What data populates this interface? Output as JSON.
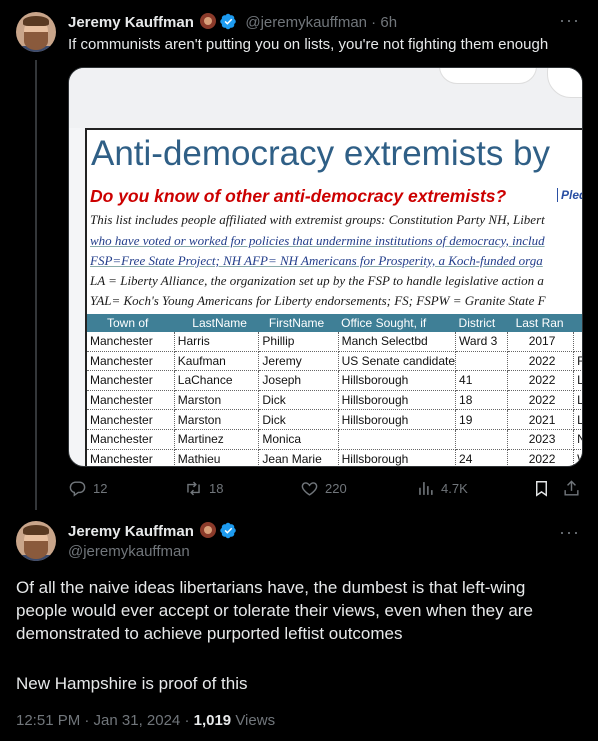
{
  "tweet1": {
    "display_name": "Jeremy Kauffman",
    "handle": "@jeremykauffman",
    "time": "6h",
    "text": "If communists aren't putting you on lists, you're not fighting them enough",
    "stats": {
      "replies": "12",
      "reposts": "18",
      "likes": "220",
      "views": "4.7K"
    },
    "image": {
      "title": "Anti-democracy extremists by",
      "subtitle": "Do you know of other anti-democracy extremists?",
      "pledge_link": "Pled",
      "lines": [
        "This list includes people affiliated with extremist groups: Constitution Party NH, Libert",
        "who have voted or worked for policies that undermine institutions of democracy, includ",
        "FSP=Free State Project; NH AFP= NH Americans for Prosperity, a Koch-funded orga",
        "LA = Liberty Alliance, the organization set up by the FSP to handle legislative action a",
        "YAL= Koch's Young Americans for Liberty endorsements; FS; FSPW = Granite State F"
      ],
      "table_headers": [
        "Town of",
        "LastName",
        "FirstName",
        "Office Sought, if",
        "District",
        "Last Ran",
        ""
      ],
      "table_rows": [
        [
          "Manchester",
          "Harris",
          "Phillip",
          "Manch Selectbd",
          "Ward 3",
          "2017",
          ""
        ],
        [
          "Manchester",
          "Kaufman",
          "Jeremy",
          "US Senate candidate",
          "",
          "2022",
          "FSP"
        ],
        [
          "Manchester",
          "LaChance",
          "Joseph",
          "Hillsborough",
          "41",
          "2022",
          "Libe"
        ],
        [
          "Manchester",
          "Marston",
          "Dick",
          "Hillsborough",
          "18",
          "2022",
          "Libe"
        ],
        [
          "Manchester",
          "Marston",
          "Dick",
          "Hillsborough",
          "19",
          "2021",
          "Libe"
        ],
        [
          "Manchester",
          "Martinez",
          "Monica",
          "",
          "",
          "2023",
          "NH"
        ],
        [
          "Manchester",
          "Mathieu",
          "Jean Marie",
          "Hillsborough",
          "24",
          "2022",
          "We"
        ]
      ]
    }
  },
  "tweet2": {
    "display_name": "Jeremy Kauffman",
    "handle": "@jeremykauffman",
    "paragraph1": "Of all the naive ideas libertarians have, the dumbest is that left-wing people would ever accept or tolerate their views, even when they are demonstrated to achieve purported leftist outcomes",
    "paragraph2": "New Hampshire is proof of this",
    "timestamp": "12:51 PM · Jan 31, 2024 · ",
    "views_count": "1,019",
    "views_label": "Views"
  },
  "colors": {
    "background": "#000000",
    "text": "#e7e9ea",
    "muted": "#71767b",
    "verified": "#1d9bf0"
  },
  "icons": [
    "more-icon",
    "verified-icon",
    "reply-icon",
    "repost-icon",
    "like-icon",
    "views-icon",
    "bookmark-icon",
    "share-icon"
  ]
}
